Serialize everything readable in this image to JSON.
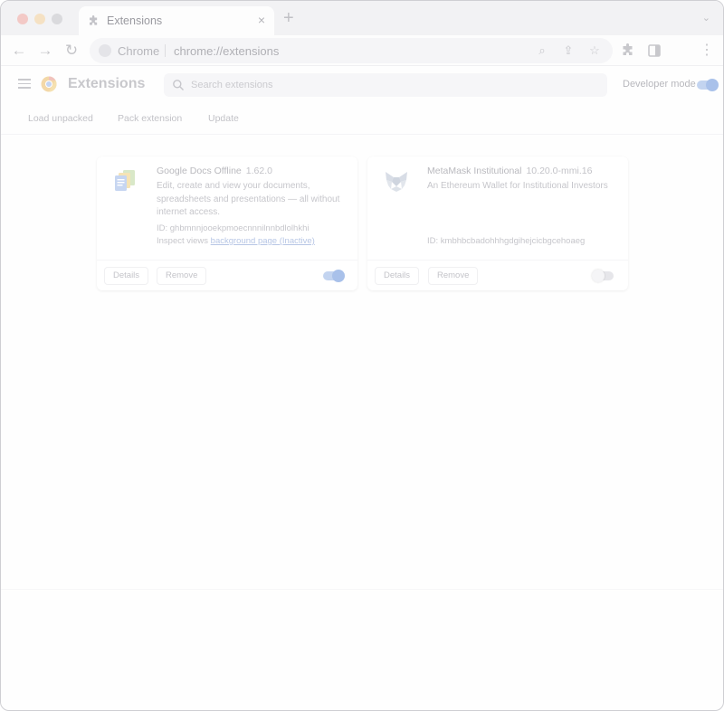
{
  "tab": {
    "title": "Extensions",
    "close": "×",
    "new_tab": "+",
    "menu": "⌄"
  },
  "toolbar": {
    "back": "←",
    "forward": "→",
    "reload": "↻",
    "url_scheme_label": "Chrome",
    "url": "chrome://extensions",
    "zoom": "⌕",
    "share": "⇪",
    "bookmark": "☆",
    "extensions": "✚",
    "side_panel": "▮",
    "menu": "⋮"
  },
  "header": {
    "title": "Extensions",
    "search_placeholder": "Search extensions",
    "developer_mode_label": "Developer mode",
    "developer_mode_on": true
  },
  "dev_buttons": {
    "load_unpacked": "Load unpacked",
    "pack_extension": "Pack extension",
    "update": "Update"
  },
  "cards": [
    {
      "name": "Google Docs Offline",
      "version": "1.62.0",
      "description": "Edit, create and view your documents, spreadsheets and presentations — all without internet access.",
      "id_label": "ID: ghbmnnjooekpmoecnnnilnnbdlolhkhi",
      "inspect_prefix": "Inspect views",
      "inspect_link": "background page (Inactive)",
      "details": "Details",
      "remove": "Remove",
      "enabled": true
    },
    {
      "name": "MetaMask Institutional",
      "version": "10.20.0-mmi.16",
      "description": "An Ethereum Wallet for Institutional Investors",
      "id_label": "ID: kmbhbcbadohhhgdgihejcicbgcehoaeg",
      "details": "Details",
      "remove": "Remove",
      "enabled": false
    }
  ]
}
